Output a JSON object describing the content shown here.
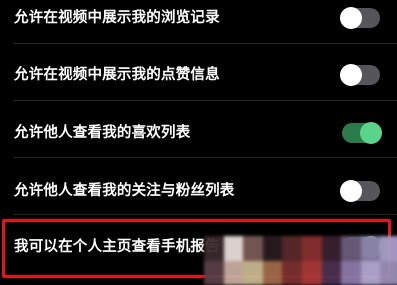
{
  "settings": {
    "items": [
      {
        "label": "允许在视频中展示我的浏览记录",
        "enabled": false
      },
      {
        "label": "允许在视频中展示我的点赞信息",
        "enabled": false
      },
      {
        "label": "允许他人查看我的喜欢列表",
        "enabled": true
      },
      {
        "label": "允许他人查看我的关注与粉丝列表",
        "enabled": false
      },
      {
        "label": "我可以在个人主页查看手机报告",
        "enabled": true
      }
    ]
  },
  "colors": {
    "background": "#000000",
    "toggle_on": "#5ad48a",
    "toggle_off": "#55555a",
    "highlight": "#e5131d"
  }
}
